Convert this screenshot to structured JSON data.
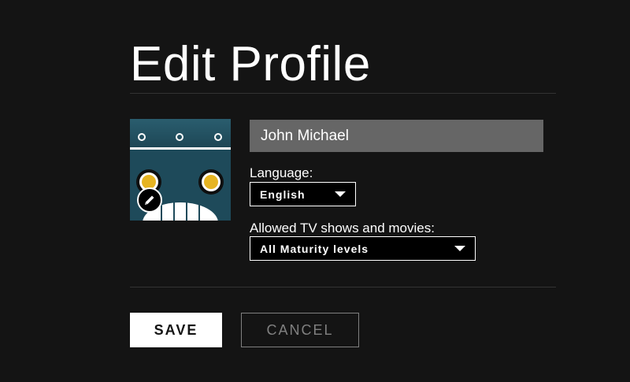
{
  "page": {
    "title": "Edit Profile"
  },
  "profile": {
    "name_value": "John Michael",
    "avatar_icon": "robot-avatar",
    "edit_icon": "pencil-icon"
  },
  "language": {
    "label": "Language:",
    "selected": "English"
  },
  "maturity": {
    "label": "Allowed TV shows and movies:",
    "selected": "All Maturity levels"
  },
  "actions": {
    "save_label": "SAVE",
    "cancel_label": "CANCEL"
  },
  "colors": {
    "background": "#141414",
    "input_bg": "#666666",
    "avatar_teal": "#1e4a5a",
    "avatar_eye": "#e6b422",
    "cancel_gray": "#808080"
  }
}
